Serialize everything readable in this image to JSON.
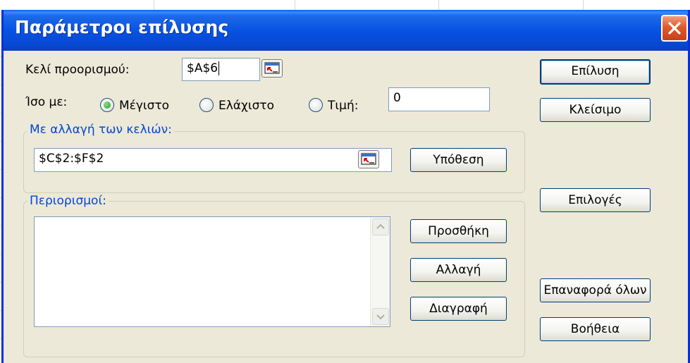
{
  "window": {
    "title": "Παράμετροι επίλυσης"
  },
  "target": {
    "label": "Κελί προορισμού:",
    "value": "$A$6"
  },
  "equal_to": {
    "label": "Ίσο με:",
    "options": [
      {
        "label": "Μέγιστο",
        "selected": true
      },
      {
        "label": "Ελάχιστο",
        "selected": false
      },
      {
        "label": "Τιμή:",
        "selected": false
      }
    ],
    "value": "0"
  },
  "changing": {
    "label": "Με αλλαγή των κελιών:",
    "value": "$C$2:$F$2",
    "guess_button": "Υπόθεση"
  },
  "constraints": {
    "label": "Περιορισμοί:",
    "items": [],
    "buttons": {
      "add": "Προσθήκη",
      "change": "Αλλαγή",
      "delete": "Διαγραφή"
    }
  },
  "side_buttons": {
    "solve": "Επίλυση",
    "close": "Κλείσιμο",
    "options": "Επιλογές",
    "reset": "Επαναφορά όλων",
    "help": "Βοήθεια"
  },
  "colors": {
    "title_bar": "#0753e3",
    "dialog_bg": "#ece9d8",
    "accent_label": "#0046d5"
  }
}
